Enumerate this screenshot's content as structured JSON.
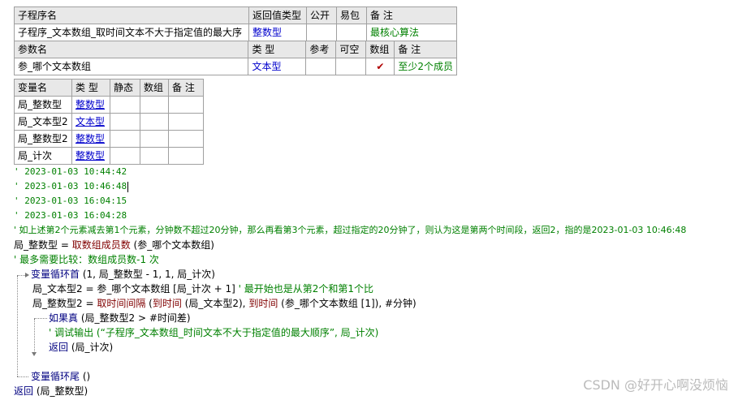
{
  "sub_table": {
    "headers": [
      "子程序名",
      "返回值类型",
      "公开",
      "易包",
      "备 注"
    ],
    "row": {
      "name": "子程序_文本数组_取时间文本不大于指定值的最大序",
      "return_type": "整数型",
      "public": "",
      "easy_pkg": "",
      "note": "最核心算法"
    }
  },
  "param_table": {
    "headers": [
      "参数名",
      "类 型",
      "参考",
      "可空",
      "数组",
      "备 注"
    ],
    "row": {
      "name": "参_哪个文本数组",
      "type": "文本型",
      "ref": "",
      "nullable": "",
      "array": "✔",
      "note": "至少2个成员"
    }
  },
  "var_table": {
    "headers": [
      "变量名",
      "类 型",
      "静态",
      "数组",
      "备 注"
    ],
    "rows": [
      {
        "name": "局_整数型",
        "type": "整数型"
      },
      {
        "name": "局_文本型2",
        "type": "文本型"
      },
      {
        "name": "局_整数型2",
        "type": "整数型"
      },
      {
        "name": "局_计次",
        "type": "整数型"
      }
    ]
  },
  "code": {
    "c1": "' 2023-01-03 10:44:42",
    "c2": "' 2023-01-03 10:46:48",
    "c3": "' 2023-01-03 16:04:15",
    "c4": "' 2023-01-03 16:04:28",
    "c5": "' 如上述第2个元素减去第1个元素，分钟数不超过20分钟，那么再看第3个元素，超过指定的20分钟了，则认为这是第两个时间段，返回2，指的是2023-01-03 10:46:48",
    "l6_a": "局_整数型 = ",
    "l6_fn": "取数组成员数",
    "l6_b": " (参_哪个文本数组)",
    "c7": "' 最多需要比较：数组成员数-1 次",
    "l8_kw": "变量循环首",
    "l8_b": " (1, 局_整数型 - 1, 1, 局_计次)",
    "l9_a": "局_文本型2 = 参_哪个文本数组 [局_计次 + 1]",
    "l9_cmt": " ' 最开始也是从第2个和第1个比",
    "l10_a": "局_整数型2 = ",
    "l10_fn1": "取时间间隔",
    "l10_b": " (",
    "l10_fn2": "到时间",
    "l10_c": " (局_文本型2), ",
    "l10_fn3": "到时间",
    "l10_d": " (参_哪个文本数组 [1]), #分钟)",
    "l11_kw": "如果真",
    "l11_b": " (局_整数型2 > #时间差)",
    "l12_cmt": "' 调试输出 (“子程序_文本数组_时间文本不大于指定值的最大顺序”, 局_计次)",
    "l13_kw": "返回",
    "l13_b": " (局_计次)",
    "l14_kw": "变量循环尾",
    "l14_b": " ()",
    "l15_kw": "返回",
    "l15_b": " (局_整数型)"
  },
  "watermark": "CSDN @好开心啊没烦恼"
}
